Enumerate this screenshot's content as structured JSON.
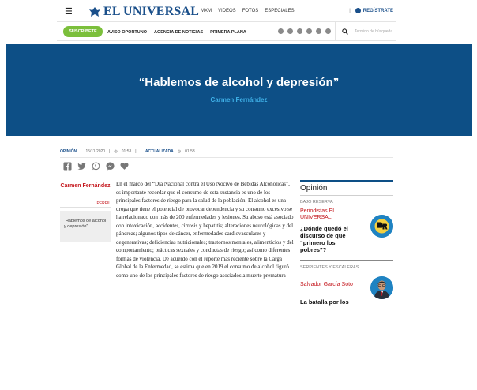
{
  "header": {
    "menu_icon": "menu-icon",
    "logo_text": "EL UNIVERSAL",
    "nav": [
      "MXM",
      "VIDEOS",
      "FOTOS",
      "ESPECIALES"
    ],
    "register_label": "REGÍSTRATE"
  },
  "navbar": {
    "subscribe_label": "SUSCRÍBETE",
    "sections": [
      "AVISO OPORTUNO",
      "AGENCIA DE NOTICIAS",
      "PRIMERA PLANA"
    ],
    "social_icons": [
      "telegram-icon",
      "facebook-icon",
      "twitter-icon",
      "youtube-icon",
      "instagram-icon",
      "pinterest-icon"
    ],
    "search_placeholder": "Termino de búsqueda"
  },
  "hero": {
    "title": "“Hablemos de alcohol y depresión”",
    "author": "Carmen Fernández",
    "background": "#0d4f86",
    "author_color": "#3fb1e8"
  },
  "meta": {
    "section": "OPINIÓN",
    "date": "15/11/2020",
    "time": "01:53",
    "updated_label": "ACTUALIZADA",
    "updated_time": "01:53"
  },
  "share_icons": [
    "facebook-icon",
    "twitter-icon",
    "whatsapp-icon",
    "messenger-icon",
    "heart-icon"
  ],
  "author_box": {
    "name": "Carmen Fernández",
    "profile_label": "PERFIL",
    "pull_quote": "“Hablemos de alcohol y depresión”"
  },
  "article": {
    "body": "En el marco del “Día Nacional contra el Uso Nocivo de Bebidas Alcohólicas”, es importante recordar que el consumo de esta sustancia es uno de los principales factores de riesgo para la salud de la población. El alcohol es una droga que tiene el potencial de provocar dependencia y su consumo excesivo se ha relacionado con más de 200 enfermedades y lesiones. Su abuso está asociado con intoxicación, accidentes, cirrosis y hepatitis; alteraciones neurológicas y del páncreas; algunos tipos de cáncer, enfermedades cardiovasculares y degenerativas; deficiencias nutricionales; trastornos mentales, alimenticios y del comportamiento; prácticas sexuales y conductas de riesgo; así como diferentes formas de violencia. De acuerdo con el reporte más reciente sobre la Carga Global de la Enfermedad, se estima que en 2019 el consumo de alcohol figuró como uno de los principales factores de riesgo asociados a muerte prematura"
  },
  "opinion": {
    "title": "Opinión",
    "cards": [
      {
        "section": "BAJO RESERVA",
        "author": "Periodistas EL UNIVERSAL",
        "headline": "¿Dónde quedó el discurso de que “primero los pobres”?"
      },
      {
        "section": "SERPIENTES Y ESCALERAS",
        "author": "Salvador García Soto",
        "headline": "La batalla por los"
      }
    ]
  },
  "colors": {
    "brand_blue": "#1a4f8a",
    "subscribe_green": "#7bbf3b",
    "accent_red": "#c4161c"
  }
}
